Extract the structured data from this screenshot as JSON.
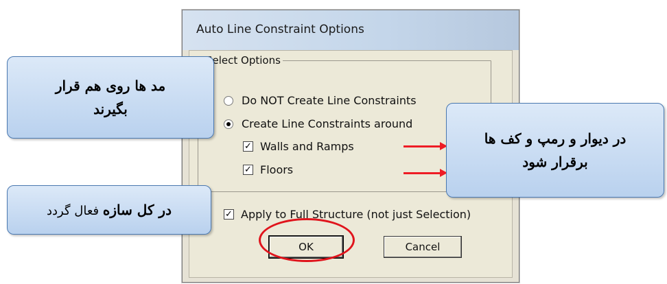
{
  "dialog": {
    "title": "Auto Line Constraint Options",
    "group_label": "Select Options",
    "options": [
      {
        "label": "Do NOT Create Line Constraints",
        "selected": false
      },
      {
        "label": "Create Line Constraints around",
        "selected": true
      }
    ],
    "checkboxes": [
      {
        "label": "Walls and Ramps",
        "checked": true
      },
      {
        "label": "Floors",
        "checked": true
      },
      {
        "label": "Apply to Full Structure (not just Selection)",
        "checked": true
      }
    ],
    "ok_label": "OK",
    "cancel_label": "Cancel"
  },
  "callouts": {
    "left_top": {
      "line1": "مد ها روی هم قرار",
      "line2": "بگیرند"
    },
    "right": {
      "line1": "در دیوار و رمپ و کف ها",
      "line2": "برقرار شود"
    },
    "left_bottom": {
      "bold": "در کل سازه",
      "rest": " فعال گردد"
    }
  },
  "colors": {
    "arrow": "#ee1c25",
    "ellipse": "#e0141c",
    "callout_border": "#4a78b0"
  }
}
